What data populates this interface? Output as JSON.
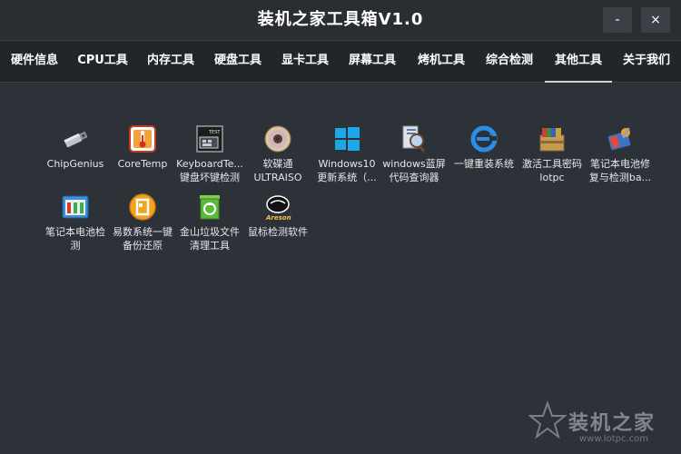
{
  "window": {
    "title": "装机之家工具箱V1.0",
    "minimize_label": "-",
    "close_label": "×"
  },
  "nav": {
    "tabs": [
      {
        "label": "硬件信息",
        "active": false
      },
      {
        "label": "CPU工具",
        "active": false
      },
      {
        "label": "内存工具",
        "active": false
      },
      {
        "label": "硬盘工具",
        "active": false
      },
      {
        "label": "显卡工具",
        "active": false
      },
      {
        "label": "屏幕工具",
        "active": false
      },
      {
        "label": "烤机工具",
        "active": false
      },
      {
        "label": "综合检测",
        "active": false
      },
      {
        "label": "其他工具",
        "active": true
      },
      {
        "label": "关于我们",
        "active": false
      }
    ]
  },
  "tools": [
    {
      "label": "ChipGenius",
      "icon": "usb-drive-icon"
    },
    {
      "label": "CoreTemp",
      "icon": "thermometer-icon"
    },
    {
      "label": "KeyboardTe...\n键盘坏键检测",
      "icon": "keyboard-test-icon"
    },
    {
      "label": "软碟通\nULTRAISO",
      "icon": "disc-icon"
    },
    {
      "label": "Windows10\n更新系统（...",
      "icon": "windows-logo-icon"
    },
    {
      "label": "windows蓝屏\n代码查询器",
      "icon": "magnifier-icon"
    },
    {
      "label": "一键重装系统",
      "icon": "ie-refresh-icon"
    },
    {
      "label": "激活工具密码\nlotpc",
      "icon": "archive-box-icon"
    },
    {
      "label": "笔记本电池修\n复与检测ba...",
      "icon": "battery-repair-icon"
    },
    {
      "label": "笔记本电池检\n测",
      "icon": "battery-monitor-icon"
    },
    {
      "label": "易数系统一键\n备份还原",
      "icon": "backup-restore-icon"
    },
    {
      "label": "金山垃圾文件\n清理工具",
      "icon": "recycle-bin-icon"
    },
    {
      "label": "鼠标检测软件",
      "icon": "mouse-icon"
    }
  ],
  "icon_text": {
    "mouse": "Areson",
    "keyboard": "TEST"
  },
  "watermark": {
    "text": "装机之家",
    "url": "www.lotpc.com"
  },
  "colors": {
    "background": "#2d3138",
    "nav": "#22252a",
    "titlebar": "#2a2d32",
    "text": "#ffffff"
  }
}
